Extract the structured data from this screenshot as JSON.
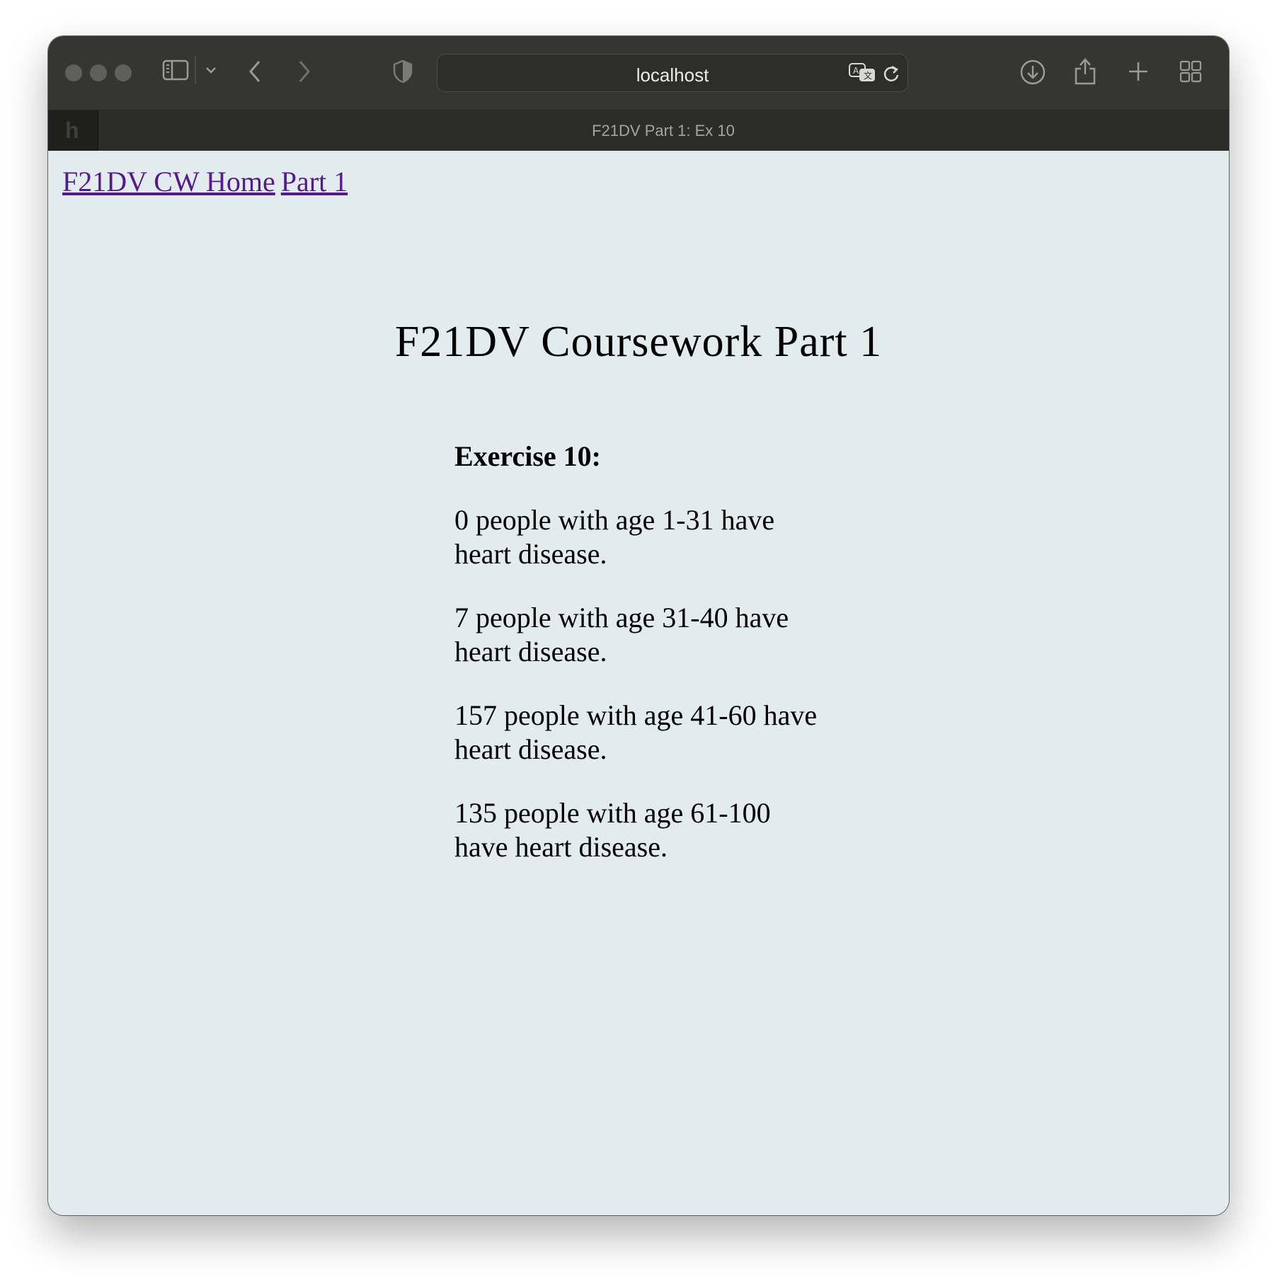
{
  "browser": {
    "address": "localhost",
    "tab_title": "F21DV Part 1: Ex 10",
    "tab_favicon": "h"
  },
  "nav": {
    "home_link": "F21DV CW Home",
    "part_link": "Part 1"
  },
  "page": {
    "heading": "F21DV Coursework Part 1",
    "exercise_title": "Exercise 10:",
    "lines": [
      "0 people with age 1-31 have heart disease.",
      "7 people with age 31-40 have heart disease.",
      "157 people with age 41-60 have heart disease.",
      "135 people with age 61-100 have heart disease."
    ]
  },
  "colors": {
    "page_background": "#e2ecee",
    "toolbar": "#353532",
    "link_visited": "#551a8b"
  }
}
